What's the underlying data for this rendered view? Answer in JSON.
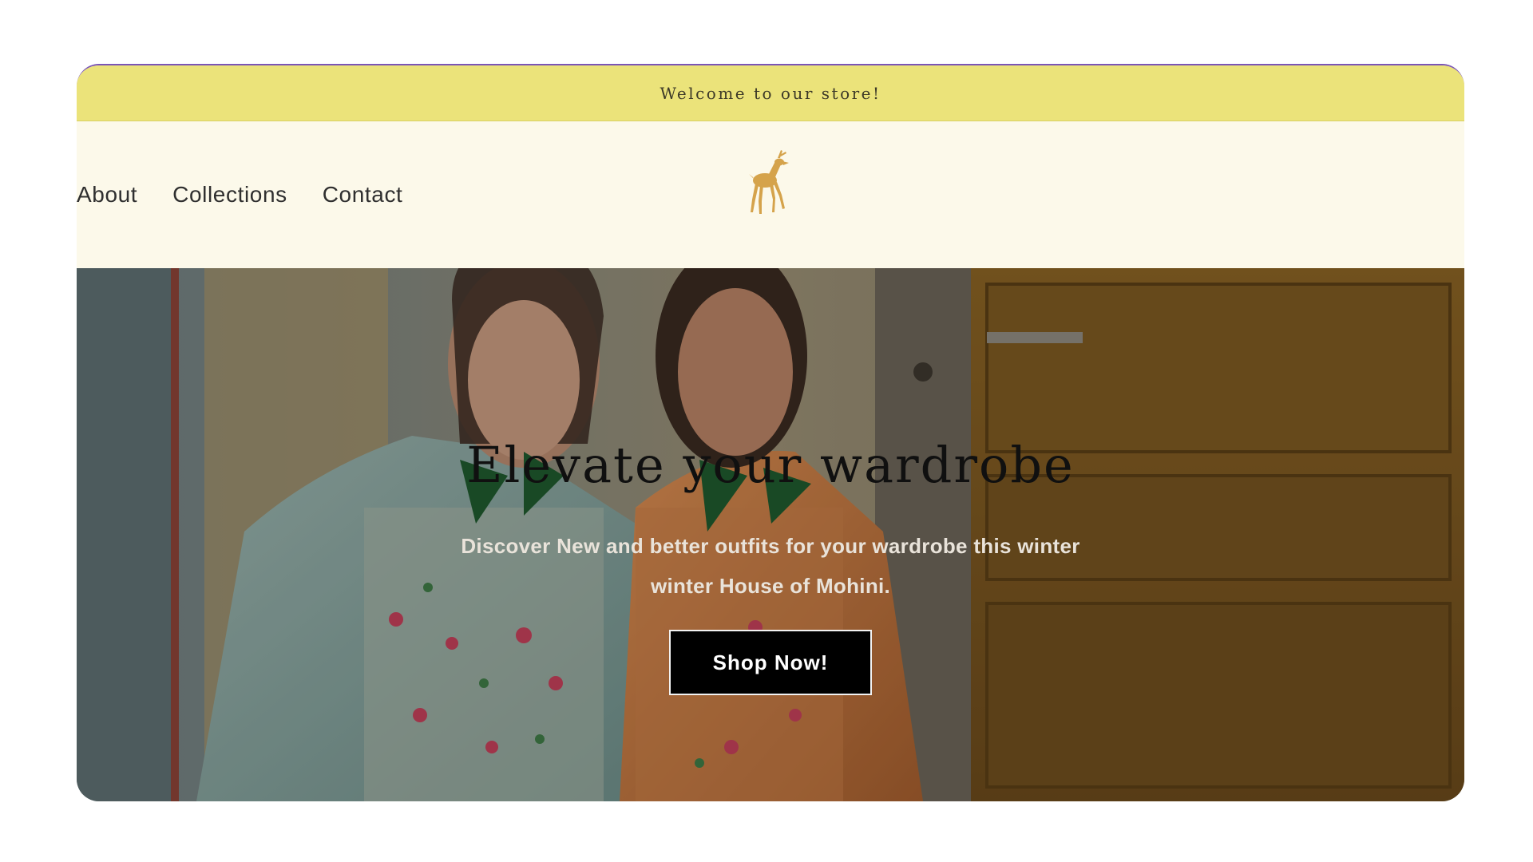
{
  "announcement": {
    "text": "Welcome to our store!"
  },
  "nav": {
    "items": [
      {
        "label": "About"
      },
      {
        "label": "Collections"
      },
      {
        "label": "Contact"
      }
    ]
  },
  "logo": {
    "icon": "deer-icon",
    "color": "#d5a34b"
  },
  "hero": {
    "title": "Elevate your wardrobe",
    "subtitle": "Discover New and better outfits for your wardrobe this winter winter House of Mohini.",
    "cta_label": "Shop Now!"
  },
  "colors": {
    "announcement_bg": "#ebe37a",
    "header_bg": "#fcf9ea",
    "button_bg": "#000000",
    "accent_border": "#7b55b5"
  }
}
